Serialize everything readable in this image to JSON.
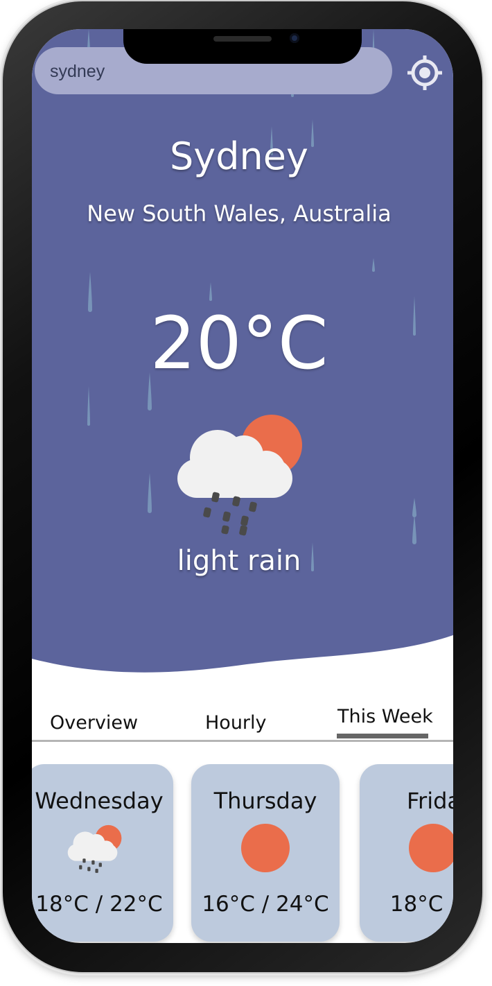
{
  "search": {
    "value": "sydney"
  },
  "location": {
    "city": "Sydney",
    "region": "New South Wales, Australia"
  },
  "current": {
    "temperature": "20°C",
    "condition": "light rain",
    "icon": "light-rain-sun-icon"
  },
  "tabs": [
    {
      "label": "Overview",
      "active": false
    },
    {
      "label": "Hourly",
      "active": false
    },
    {
      "label": "This Week",
      "active": true
    }
  ],
  "forecast": [
    {
      "day": "Wednesday",
      "temps": "18°C / 22°C",
      "icon": "light-rain-sun-icon"
    },
    {
      "day": "Thursday",
      "temps": "16°C / 24°C",
      "icon": "sun-icon"
    },
    {
      "day": "Frida",
      "temps": "18°C / 2",
      "icon": "sun-icon"
    }
  ],
  "colors": {
    "sky": "#5c649c",
    "sun": "#ea6d4b",
    "card": "#bdcadd",
    "cloud": "#f1f1f1"
  }
}
